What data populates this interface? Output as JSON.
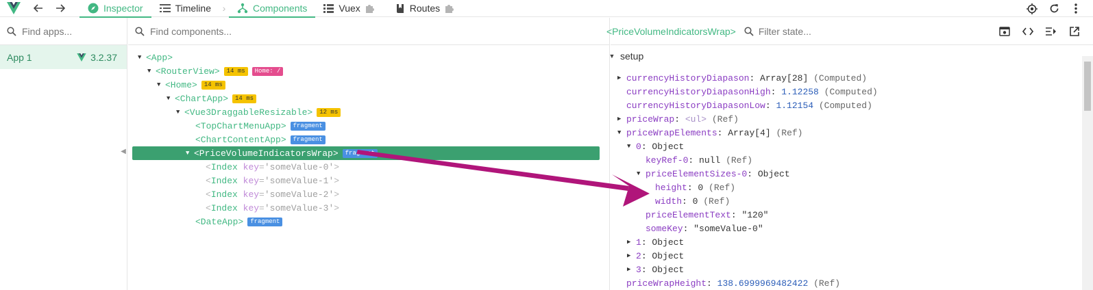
{
  "topbar": {
    "tabs": [
      {
        "label": "Inspector"
      },
      {
        "label": "Timeline"
      },
      {
        "label": "Components"
      },
      {
        "label": "Vuex"
      },
      {
        "label": "Routes"
      }
    ]
  },
  "apps": {
    "search_placeholder": "Find apps...",
    "items": [
      {
        "name": "App 1",
        "version": "3.2.37"
      }
    ]
  },
  "components": {
    "search_placeholder": "Find components...",
    "tree": [
      {
        "name": "<App>"
      },
      {
        "name": "<RouterView>",
        "badges": [
          "14 ms",
          "Home: /"
        ]
      },
      {
        "name": "<Home>",
        "badges": [
          "14 ms"
        ]
      },
      {
        "name": "<ChartApp>",
        "badges": [
          "14 ms"
        ]
      },
      {
        "name": "<Vue3DraggableResizable>",
        "badges": [
          "12 ms"
        ]
      },
      {
        "name": "<TopChartMenuApp>",
        "badges": [
          "fragment"
        ]
      },
      {
        "name": "<ChartContentApp>",
        "badges": [
          "fragment"
        ]
      },
      {
        "name": "<PriceVolumeIndicatorsWrap>",
        "badges": [
          "fragment"
        ]
      },
      {
        "name": "Index",
        "attr_key": "key",
        "attr_val": "'someValue-0'"
      },
      {
        "name": "Index",
        "attr_key": "key",
        "attr_val": "'someValue-1'"
      },
      {
        "name": "Index",
        "attr_key": "key",
        "attr_val": "'someValue-2'"
      },
      {
        "name": "Index",
        "attr_key": "key",
        "attr_val": "'someValue-3'"
      },
      {
        "name": "<DateApp>",
        "badges": [
          "fragment"
        ]
      }
    ]
  },
  "state": {
    "selected_component": "<PriceVolumeIndicatorsWrap>",
    "filter_placeholder": "Filter state...",
    "section": "setup",
    "rows": [
      {
        "key": "currencyHistoryDiapason",
        "value": "Array[28]",
        "meta": "(Computed)"
      },
      {
        "key": "currencyHistoryDiapasonHigh",
        "value": "1.12258",
        "meta": "(Computed)"
      },
      {
        "key": "currencyHistoryDiapasonLow",
        "value": "1.12154",
        "meta": "(Computed)"
      },
      {
        "key": "priceWrap",
        "value": "<ul>",
        "meta": "(Ref)"
      },
      {
        "key": "priceWrapElements",
        "value": "Array[4]",
        "meta": "(Ref)"
      },
      {
        "key": "0",
        "value": "Object"
      },
      {
        "key": "keyRef-0",
        "value": "null",
        "meta": "(Ref)"
      },
      {
        "key": "priceElementSizes-0",
        "value": "Object"
      },
      {
        "key": "height",
        "value": "0",
        "meta": "(Ref)"
      },
      {
        "key": "width",
        "value": "0",
        "meta": "(Ref)"
      },
      {
        "key": "priceElementText",
        "value": "\"120\""
      },
      {
        "key": "someKey",
        "value": "\"someValue-0\""
      },
      {
        "key": "1",
        "value": "Object"
      },
      {
        "key": "2",
        "value": "Object"
      },
      {
        "key": "3",
        "value": "Object"
      },
      {
        "key": "priceWrapHeight",
        "value": "138.6999969482422",
        "meta": "(Ref)"
      }
    ]
  },
  "colors": {
    "vue_green": "#42b883",
    "selected_row": "#3ba070",
    "arrow": "#b0157a"
  }
}
